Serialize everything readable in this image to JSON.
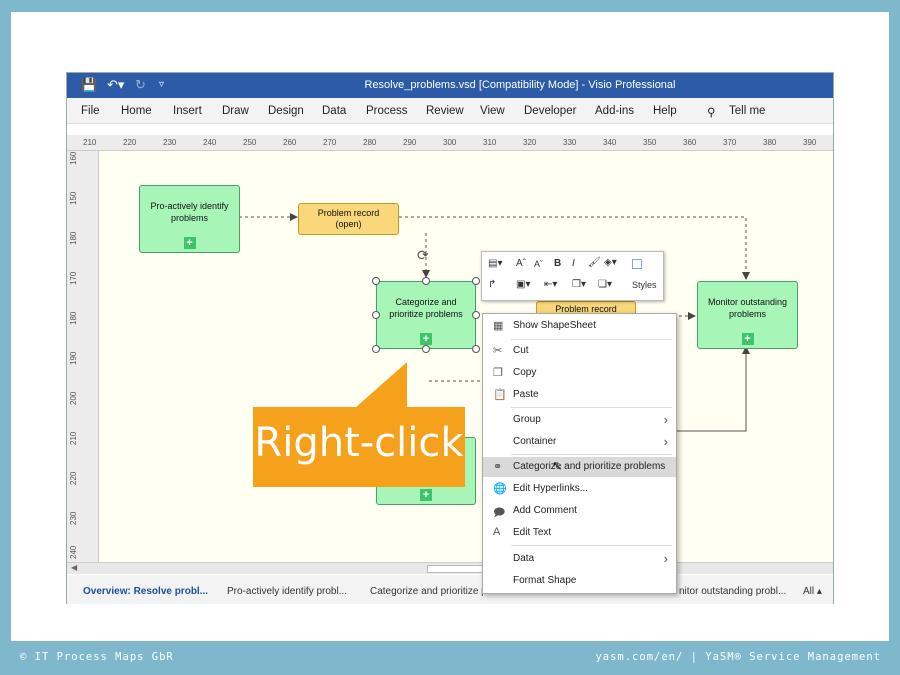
{
  "window": {
    "title": "Resolve_problems.vsd  [Compatibility Mode]  -  Visio Professional"
  },
  "menu": [
    "File",
    "Home",
    "Insert",
    "Draw",
    "Design",
    "Data",
    "Process",
    "Review",
    "View",
    "Developer",
    "Add-ins",
    "Help"
  ],
  "tellme": "Tell me",
  "ruler_h": [
    "210",
    "220",
    "230",
    "240",
    "250",
    "260",
    "270",
    "280",
    "290",
    "300",
    "310",
    "320",
    "330",
    "340",
    "350",
    "360",
    "370",
    "380",
    "390"
  ],
  "ruler_v": [
    "160",
    "150",
    "180",
    "170",
    "180",
    "190",
    "200",
    "210",
    "220",
    "230",
    "240"
  ],
  "shapes": {
    "proactive": "Pro-actively identify problems",
    "categorize": "Categorize and prioritize problems",
    "monitor": "Monitor outstanding problems",
    "note_open": "Problem record (open)",
    "note_record": "Problem record"
  },
  "minitoolbar": {
    "styles": "Styles",
    "bold": "B",
    "italic": "I",
    "grow": "A",
    "shrink": "A"
  },
  "context_menu": {
    "show_shapesheet": "Show ShapeSheet",
    "cut": "Cut",
    "copy": "Copy",
    "paste": "Paste",
    "group": "Group",
    "container": "Container",
    "hyperlink_item": "Categorize and prioritize problems",
    "edit_hyperlinks": "Edit Hyperlinks...",
    "add_comment": "Add Comment",
    "edit_text": "Edit Text",
    "data": "Data",
    "format_shape": "Format Shape"
  },
  "status_tabs": [
    "Overview: Resolve probl...",
    "Pro-actively identify probl...",
    "Categorize and prioritize p",
    "nitor outstanding probl...",
    "All"
  ],
  "callout": "Right-click",
  "footer": {
    "left": "© IT Process Maps GbR",
    "right": "yasm.com/en/ | YaSM® Service Management"
  },
  "colors": {
    "titlebar": "#2d5ba8",
    "process_shape": "#a8f5b8",
    "note": "#f9d77a",
    "callout": "#f5a11c",
    "frame": "#7fb8cc"
  }
}
